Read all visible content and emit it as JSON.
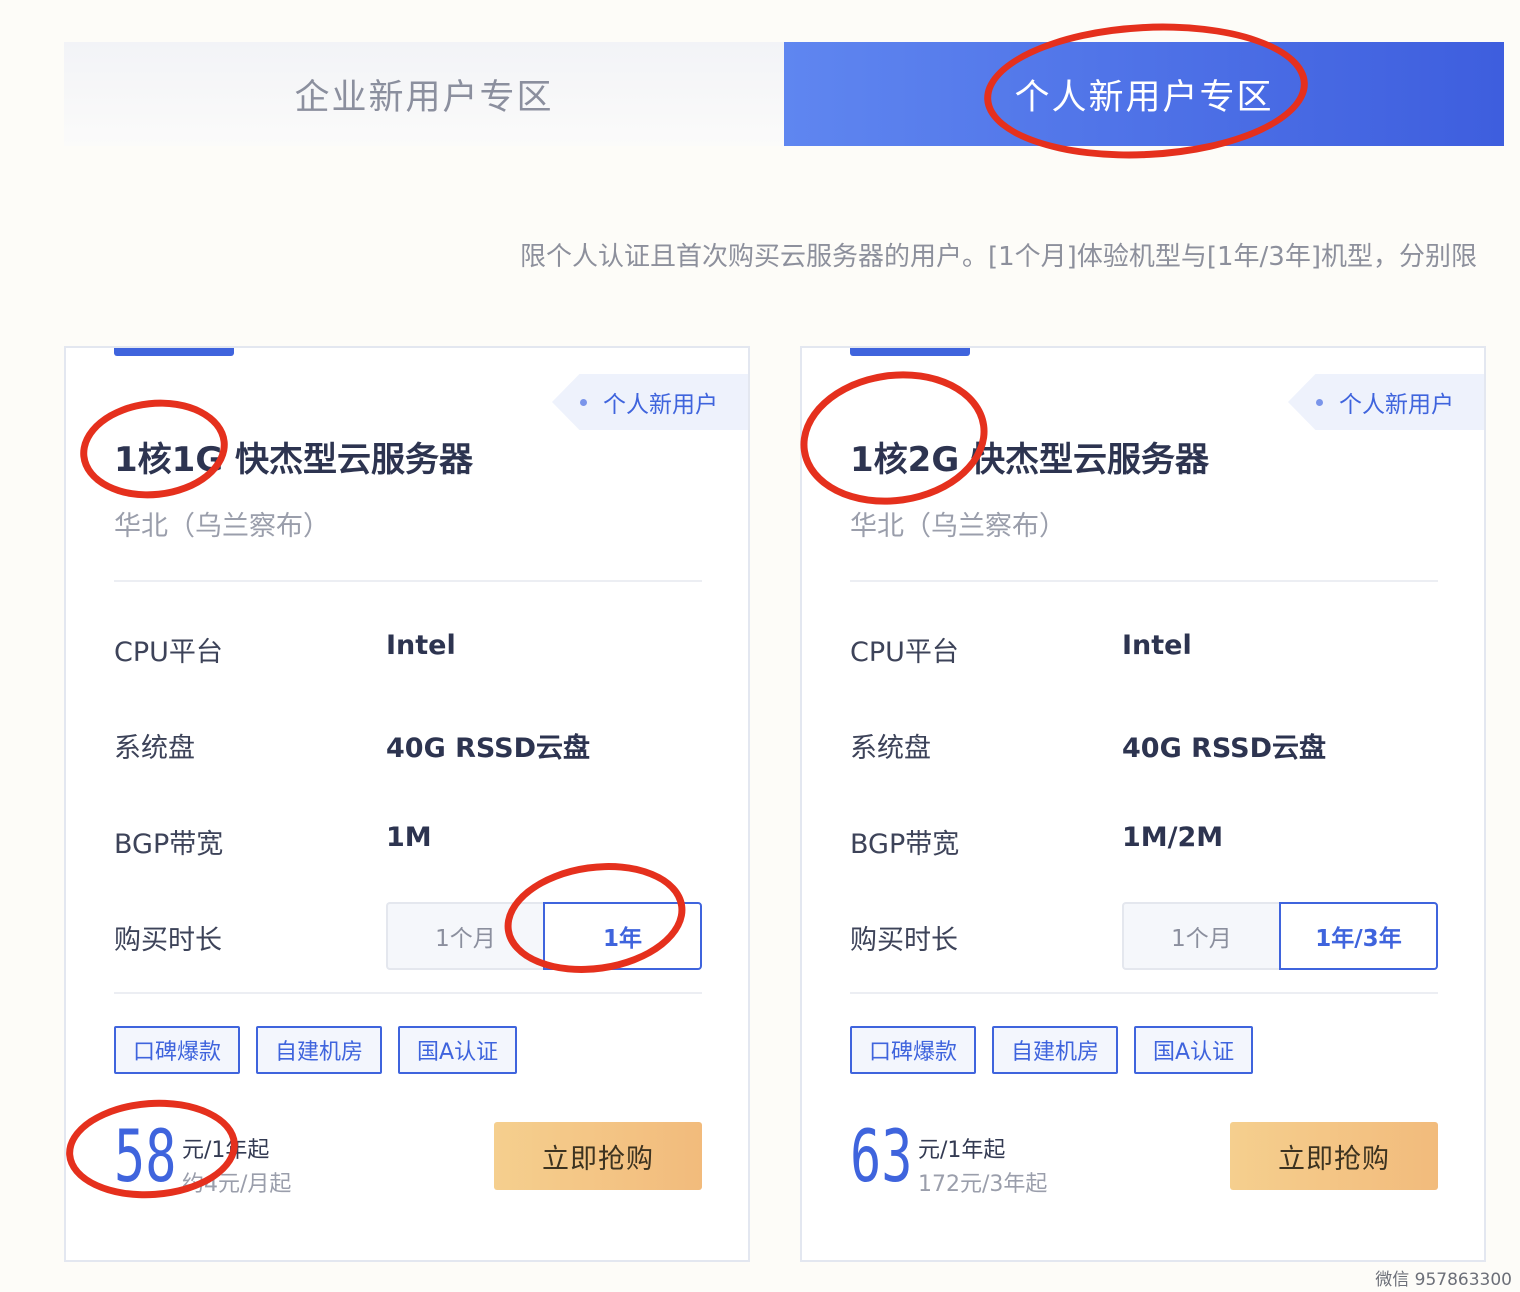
{
  "tabs": {
    "enterprise": "企业新用户专区",
    "personal": "个人新用户专区",
    "active": "personal"
  },
  "subtitle": "限个人认证且首次购买云服务器的用户。[1个月]体验机型与[1年/3年]机型，分别限",
  "cards": [
    {
      "badge": "个人新用户",
      "title": "1核1G 快杰型云服务器",
      "region": "华北（乌兰察布）",
      "specs": [
        {
          "label": "CPU平台",
          "value": "Intel"
        },
        {
          "label": "系统盘",
          "value": "40G RSSD云盘"
        },
        {
          "label": "BGP带宽",
          "value": "1M"
        }
      ],
      "duration": {
        "label": "购买时长",
        "options": [
          "1个月",
          "1年"
        ],
        "selected": "1年"
      },
      "tags": [
        "口碑爆款",
        "自建机房",
        "国A认证"
      ],
      "price": "58",
      "price_unit": "元/1年起",
      "price_sub": "约4元/月起",
      "buy_label": "立即抢购"
    },
    {
      "badge": "个人新用户",
      "title": "1核2G 快杰型云服务器",
      "region": "华北（乌兰察布）",
      "specs": [
        {
          "label": "CPU平台",
          "value": "Intel"
        },
        {
          "label": "系统盘",
          "value": "40G RSSD云盘"
        },
        {
          "label": "BGP带宽",
          "value": "1M/2M"
        }
      ],
      "duration": {
        "label": "购买时长",
        "options": [
          "1个月",
          "1年/3年"
        ],
        "selected": "1年/3年"
      },
      "tags": [
        "口碑爆款",
        "自建机房",
        "国A认证"
      ],
      "price": "63",
      "price_unit": "元/1年起",
      "price_sub": "172元/3年起",
      "buy_label": "立即抢购"
    }
  ],
  "watermark": "微信 957863300",
  "colors": {
    "accent": "#3f64dd",
    "annotation": "#e5301d",
    "buy_button": "#f3c283"
  }
}
